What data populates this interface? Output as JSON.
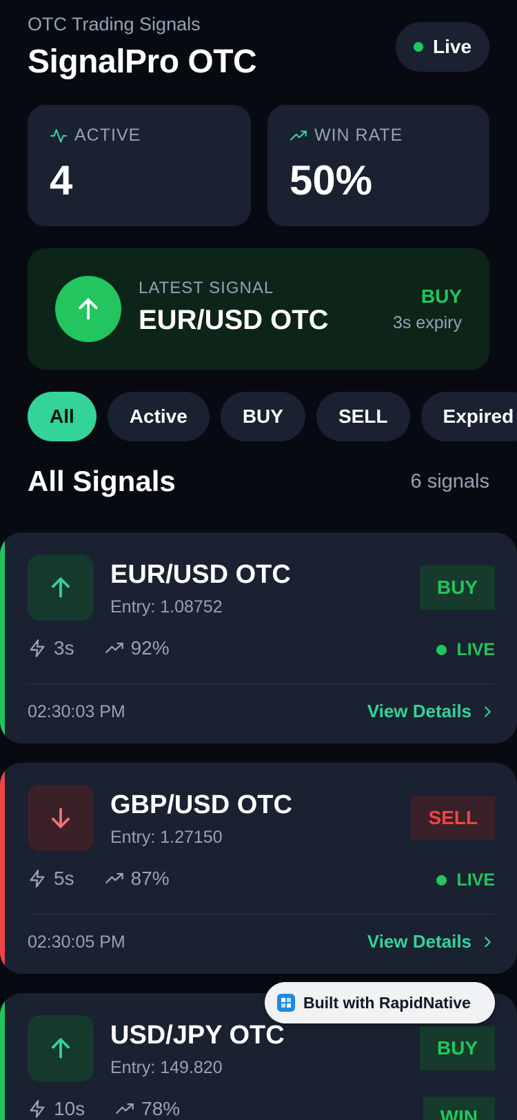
{
  "header": {
    "subtitle": "OTC Trading Signals",
    "title": "SignalPro OTC",
    "live_label": "Live"
  },
  "stats": {
    "active": {
      "label": "ACTIVE",
      "value": "4"
    },
    "win_rate": {
      "label": "WIN RATE",
      "value": "50%"
    }
  },
  "latest_signal": {
    "label": "LATEST SIGNAL",
    "pair": "EUR/USD OTC",
    "direction": "BUY",
    "expiry": "3s expiry"
  },
  "filters": [
    "All",
    "Active",
    "BUY",
    "SELL",
    "Expired"
  ],
  "section": {
    "title": "All Signals",
    "count": "6 signals"
  },
  "signals": [
    {
      "pair": "EUR/USD OTC",
      "entry": "Entry: 1.08752",
      "direction": "BUY",
      "expiry": "3s",
      "accuracy": "92%",
      "status": "LIVE",
      "time": "02:30:03 PM",
      "view_label": "View Details"
    },
    {
      "pair": "GBP/USD OTC",
      "entry": "Entry: 1.27150",
      "direction": "SELL",
      "expiry": "5s",
      "accuracy": "87%",
      "status": "LIVE",
      "time": "02:30:05 PM",
      "view_label": "View Details"
    },
    {
      "pair": "USD/JPY OTC",
      "entry": "Entry: 149.820",
      "direction": "BUY",
      "expiry": "10s",
      "accuracy": "78%",
      "status": "WIN"
    }
  ],
  "badge": {
    "label": "Built with RapidNative"
  },
  "colors": {
    "buy": "#22c55e",
    "sell": "#ef4444",
    "accent": "#34d399",
    "card": "#1a2130",
    "background": "#070b11"
  }
}
